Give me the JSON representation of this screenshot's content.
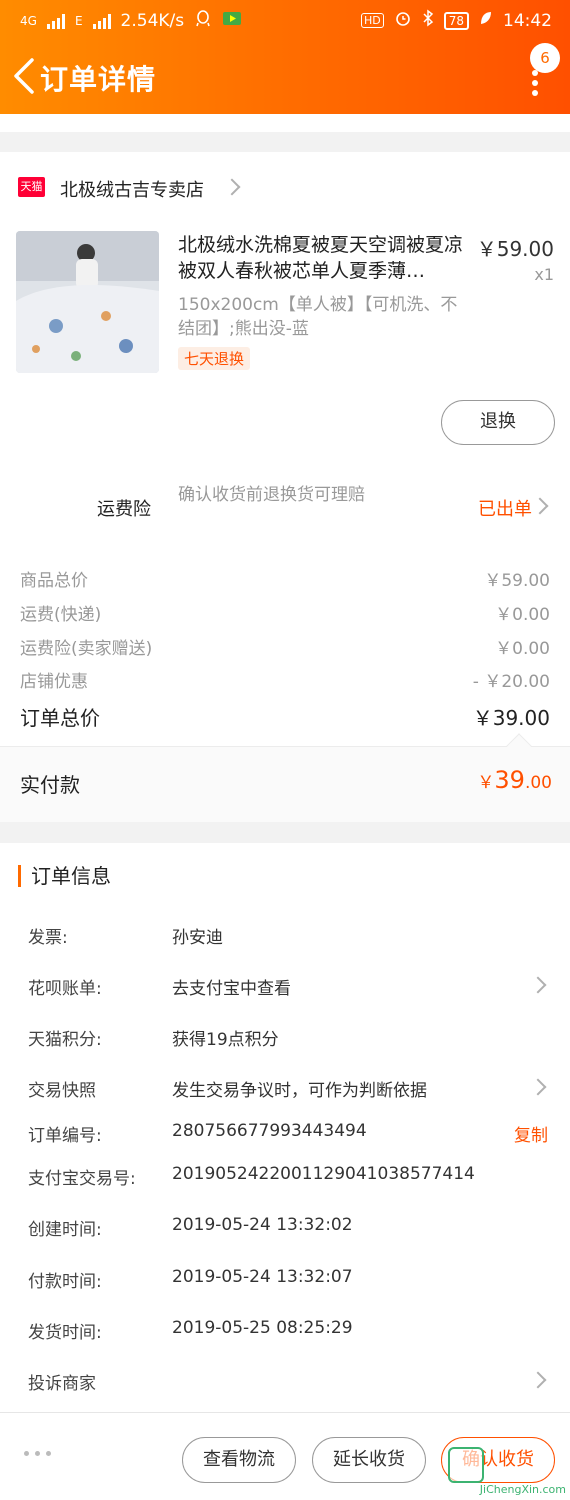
{
  "status_bar": {
    "network_1": "4G",
    "network_2": "E",
    "speed": "2.54K/s",
    "hd": "HD",
    "battery": "78",
    "time": "14:42"
  },
  "nav": {
    "title": "订单详情",
    "badge_count": "6"
  },
  "shop": {
    "icon_text": "天猫",
    "name": "北极绒古吉专卖店"
  },
  "product": {
    "name": "北极绒水洗棉夏被夏天空调被夏凉被双人春秋被芯单人夏季薄…",
    "spec": "150x200cm【单人被】【可机洗、不结团】;熊出没-蓝",
    "tag": "七天退换",
    "price": "￥59.00",
    "qty": "x1",
    "action": "退换"
  },
  "insurance": {
    "title": "运费险",
    "desc": "确认收货前退换货可理赔",
    "status": "已出单"
  },
  "price_rows": [
    {
      "label": "商品总价",
      "value": "￥59.00"
    },
    {
      "label": "运费(快递)",
      "value": "￥0.00"
    },
    {
      "label": "运费险(卖家赠送)",
      "value": "￥0.00"
    },
    {
      "label": "店铺优惠",
      "value": "- ￥20.00"
    }
  ],
  "order_total": {
    "label": "订单总价",
    "value": "￥39.00"
  },
  "paid": {
    "label": "实付款",
    "currency": "￥",
    "integer": "39",
    "decimal": ".00"
  },
  "order_info": {
    "title": "订单信息",
    "rows": [
      {
        "label": "发票:",
        "value": "孙安迪"
      },
      {
        "label": "花呗账单:",
        "value": "去支付宝中查看"
      },
      {
        "label": "天猫积分:",
        "value": "获得19点积分"
      },
      {
        "label": "交易快照",
        "value": "发生交易争议时，可作为判断依据"
      },
      {
        "label": "订单编号:",
        "value": "280756677993443494",
        "action": "复制"
      },
      {
        "label": "支付宝交易号:",
        "value": "2019052422001129041038577414"
      },
      {
        "label": "创建时间:",
        "value": "2019-05-24 13:32:02"
      },
      {
        "label": "付款时间:",
        "value": "2019-05-24 13:32:07"
      },
      {
        "label": "发货时间:",
        "value": "2019-05-25 08:25:29"
      },
      {
        "label": "投诉商家",
        "value": ""
      }
    ]
  },
  "bottom_bar": {
    "logistics": "查看物流",
    "extend": "延长收货",
    "confirm": "确认收货",
    "watermark": "JiChengXin.com"
  },
  "colors": {
    "accent": "#ff5000",
    "header_start": "#ff8c00",
    "header_end": "#ff5000",
    "tmall_red": "#ff0036"
  }
}
